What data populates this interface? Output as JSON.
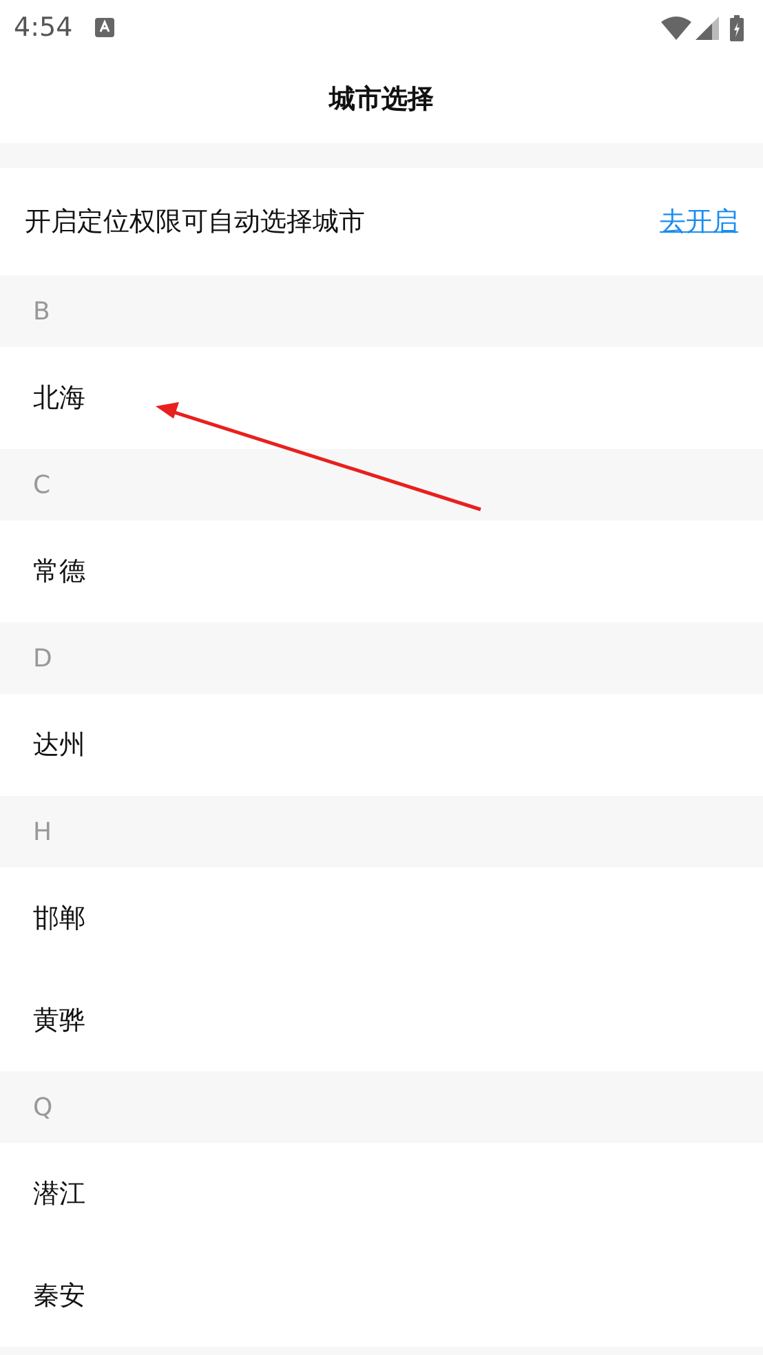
{
  "status_bar": {
    "time": "4:54"
  },
  "header": {
    "title": "城市选择"
  },
  "location_prompt": {
    "text": "开启定位权限可自动选择城市",
    "link": "去开启"
  },
  "sections": [
    {
      "letter": "B",
      "cities": [
        "北海"
      ]
    },
    {
      "letter": "C",
      "cities": [
        "常德"
      ]
    },
    {
      "letter": "D",
      "cities": [
        "达州"
      ]
    },
    {
      "letter": "H",
      "cities": [
        "邯郸",
        "黄骅"
      ]
    },
    {
      "letter": "Q",
      "cities": [
        "潜江",
        "秦安"
      ]
    }
  ]
}
